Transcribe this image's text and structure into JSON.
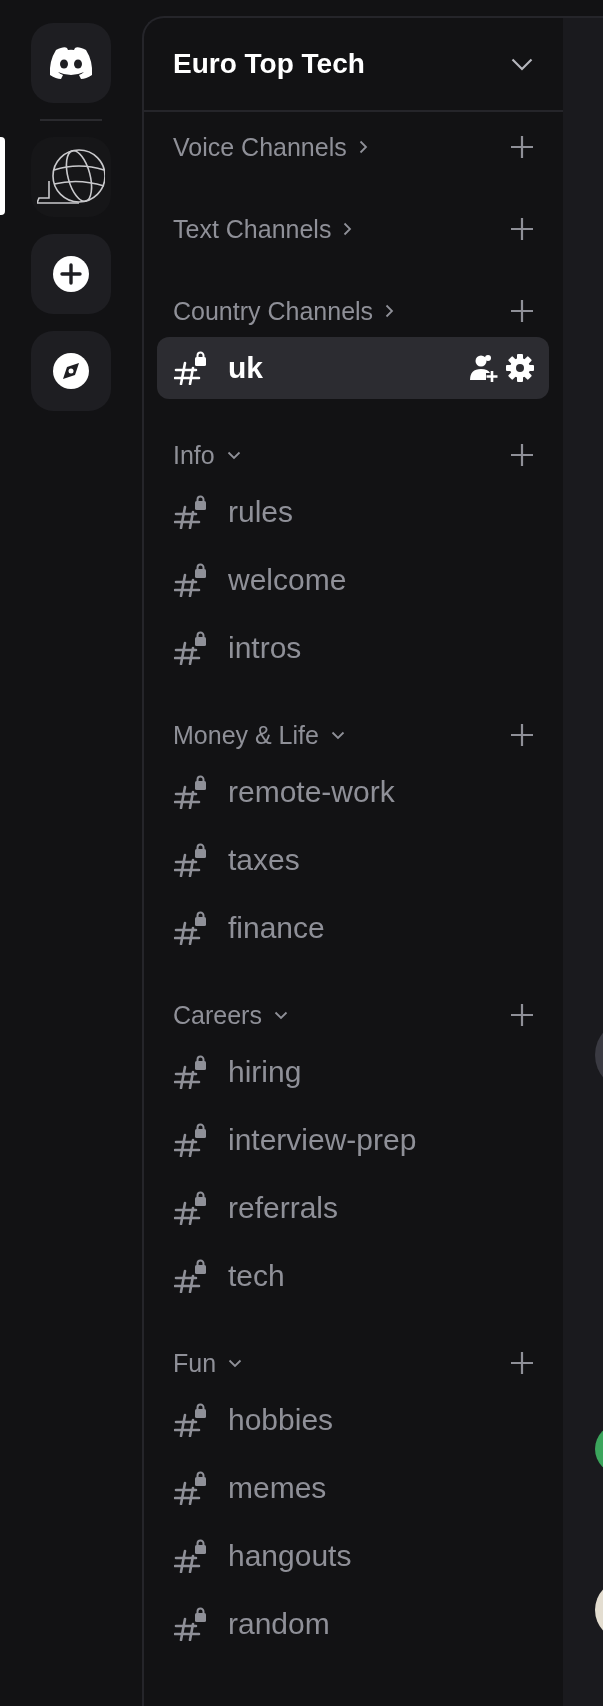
{
  "server": {
    "name": "Euro Top Tech"
  },
  "categories": [
    {
      "name": "Voice Channels",
      "expanded": false
    },
    {
      "name": "Text Channels",
      "expanded": false
    },
    {
      "name": "Country Channels",
      "expanded": false,
      "channels": [
        {
          "name": "uk",
          "selected": true
        }
      ]
    },
    {
      "name": "Info",
      "expanded": true,
      "channels": [
        {
          "name": "rules",
          "selected": false
        },
        {
          "name": "welcome",
          "selected": false
        },
        {
          "name": "intros",
          "selected": false
        }
      ]
    },
    {
      "name": "Money & Life",
      "expanded": true,
      "channels": [
        {
          "name": "remote-work",
          "selected": false
        },
        {
          "name": "taxes",
          "selected": false
        },
        {
          "name": "finance",
          "selected": false
        }
      ]
    },
    {
      "name": "Careers",
      "expanded": true,
      "channels": [
        {
          "name": "hiring",
          "selected": false
        },
        {
          "name": "interview-prep",
          "selected": false
        },
        {
          "name": "referrals",
          "selected": false
        },
        {
          "name": "tech",
          "selected": false
        }
      ]
    },
    {
      "name": "Fun",
      "expanded": true,
      "channels": [
        {
          "name": "hobbies",
          "selected": false
        },
        {
          "name": "memes",
          "selected": false
        },
        {
          "name": "hangouts",
          "selected": false
        },
        {
          "name": "random",
          "selected": false
        }
      ]
    }
  ]
}
